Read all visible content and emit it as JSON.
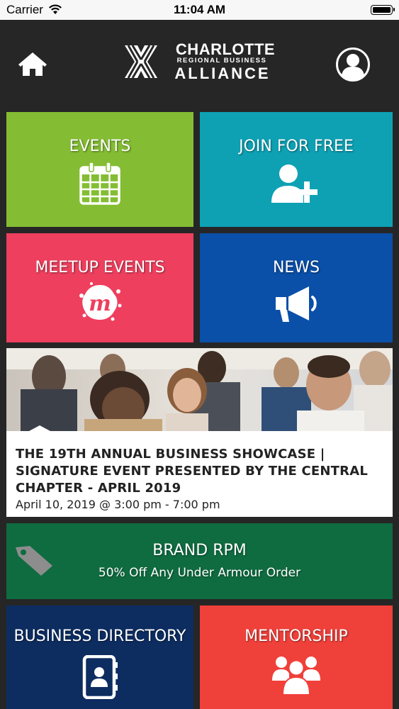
{
  "status_bar": {
    "carrier": "Carrier",
    "time": "11:04 AM"
  },
  "header": {
    "logo_line1": "CHARLOTTE",
    "logo_line2": "REGIONAL BUSINESS",
    "logo_line3": "ALLIANCE",
    "home_icon": "home-icon",
    "profile_icon": "user-circle-icon"
  },
  "tiles": [
    {
      "label": "EVENTS",
      "icon": "calendar-icon",
      "color": "#84bd33"
    },
    {
      "label": "JOIN FOR FREE",
      "icon": "user-plus-icon",
      "color": "#0ea1b4"
    },
    {
      "label": "MEETUP EVENTS",
      "icon": "meetup-icon",
      "color": "#ee3f5e"
    },
    {
      "label": "NEWS",
      "icon": "megaphone-icon",
      "color": "#0a4fa8"
    }
  ],
  "featured_event": {
    "title": "THE 19TH ANNUAL BUSINESS SHOWCASE | SIGNATURE EVENT PRESENTED BY THE CENTRAL CHAPTER - APRIL 2019",
    "date": "April 10, 2019 @ 3:00 pm - 7:00 pm"
  },
  "promo": {
    "title": "BRAND RPM",
    "subtitle": "50% Off Any Under Armour Order",
    "icon": "tag-icon",
    "color": "#0f6b40"
  },
  "bottom_tiles": [
    {
      "label": "BUSINESS DIRECTORY",
      "icon": "address-book-icon",
      "color": "#0d2d61"
    },
    {
      "label": "MENTORSHIP",
      "icon": "group-icon",
      "color": "#f0403a"
    }
  ]
}
